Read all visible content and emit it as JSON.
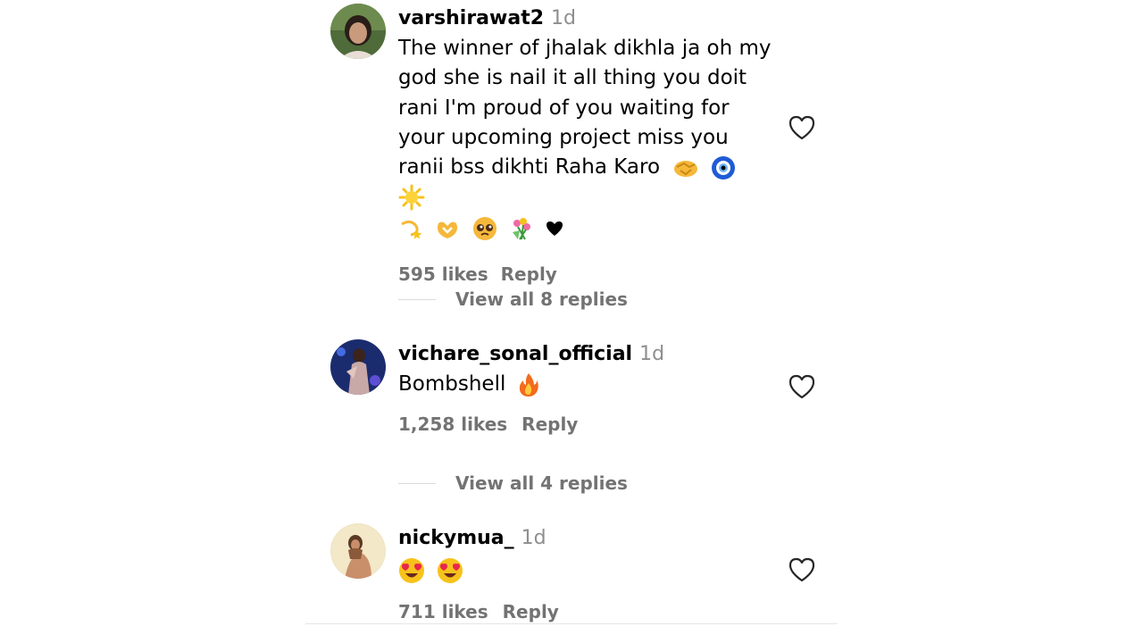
{
  "comments": [
    {
      "username": "varshirawat2",
      "time": "1d",
      "text_lines": [
        "The winner of jhalak dikhla ja oh my",
        "god she is nail it all thing you doit",
        "rani I'm proud of you waiting for",
        "your upcoming project miss you",
        "ranii bss dikhti Raha Karo"
      ],
      "emojis_inline": [
        "handshake-emoji",
        "nazar-amulet-emoji",
        "sun-emoji"
      ],
      "emojis_line2": [
        "dizzy-emoji",
        "heart-hands-emoji",
        "pleading-face-emoji",
        "bouquet-emoji",
        "black-heart-emoji"
      ],
      "likes": "595 likes",
      "reply_label": "Reply",
      "view_replies": "View all 8 replies"
    },
    {
      "username": "vichare_sonal_official",
      "time": "1d",
      "text": "Bombshell",
      "emojis_inline": [
        "fire-emoji"
      ],
      "likes": "1,258 likes",
      "reply_label": "Reply",
      "view_replies": "View all 4 replies"
    },
    {
      "username": "nickymua_",
      "time": "1d",
      "emojis_inline": [
        "heart-eyes-emoji",
        "heart-eyes-emoji"
      ],
      "likes": "711 likes",
      "reply_label": "Reply"
    }
  ],
  "colors": {
    "text": "#000000",
    "muted": "#737373",
    "timestamp": "#8e8e8e",
    "divider": "#dbdbdb"
  }
}
